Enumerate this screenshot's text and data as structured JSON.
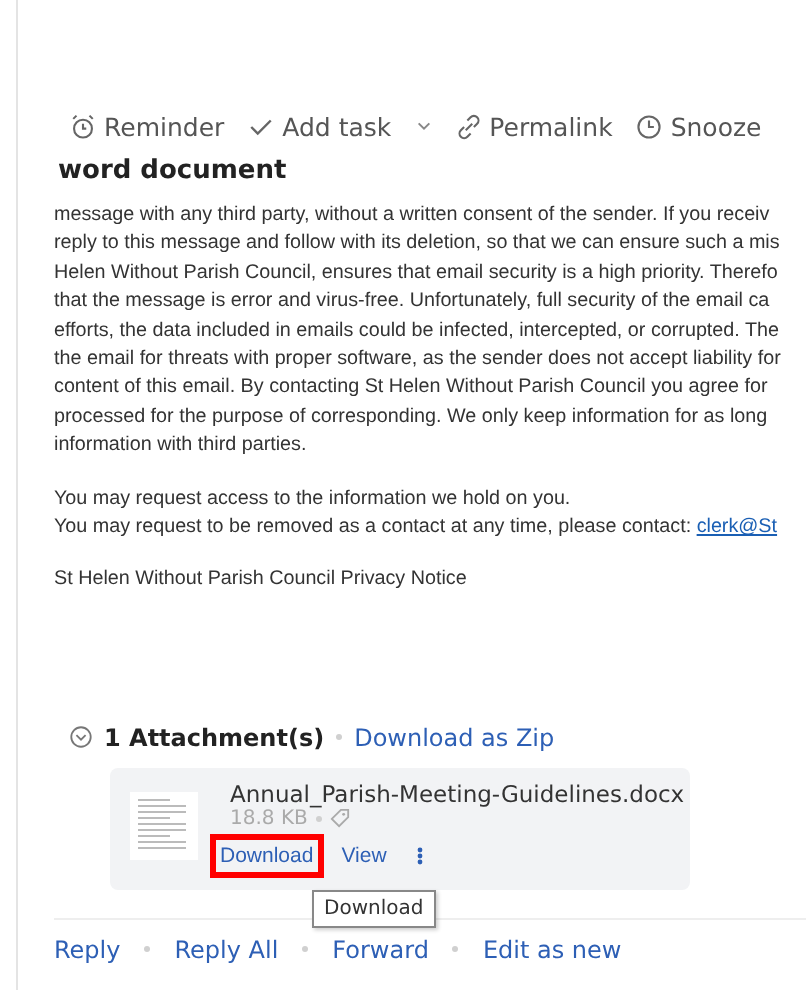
{
  "toolbar": [
    {
      "kind": "reminder",
      "label": "Reminder"
    },
    {
      "kind": "task",
      "label": "Add task",
      "dropdown": true
    },
    {
      "kind": "link",
      "label": "Permalink"
    },
    {
      "kind": "snooze",
      "label": "Snooze"
    }
  ],
  "subject": "word document",
  "body": {
    "lines": [
      "message with any third party, without a written consent of the sender.  If you receiv",
      "reply to this message and follow with its deletion, so that we can ensure such a mis",
      "Helen Without Parish Council, ensures that email security is a high priority.  Therefo",
      "that the message is error and virus-free.  Unfortunately, full security of the email ca",
      "efforts, the data included in emails could be infected, intercepted, or corrupted.  The",
      "the email for threats with proper software, as the sender does not accept liability for",
      "content of this email.  By contacting St Helen Without Parish Council you agree for",
      "processed for the purpose of corresponding.  We only keep information for as long",
      "information with third parties."
    ],
    "request_lines": [
      "You may request access to the information we hold on you.",
      "You may request to be removed as a contact at any time, please contact: "
    ],
    "contact_link": "clerk@St",
    "footer": "St Helen Without Parish Council Privacy Notice"
  },
  "attachments": {
    "expanded": true,
    "count_label": "1 Attachment(s)",
    "zip_link": "Download as Zip",
    "files": [
      {
        "name": "Annual_Parish-Meeting-Guidelines.docx",
        "size": "18.8 KB",
        "actions": [
          {
            "label": "Download",
            "highlighted": true
          },
          {
            "label": "View",
            "highlighted": false
          }
        ]
      }
    ]
  },
  "tooltip": "Download",
  "actions": [
    "Reply",
    "Reply All",
    "Forward",
    "Edit as new"
  ]
}
